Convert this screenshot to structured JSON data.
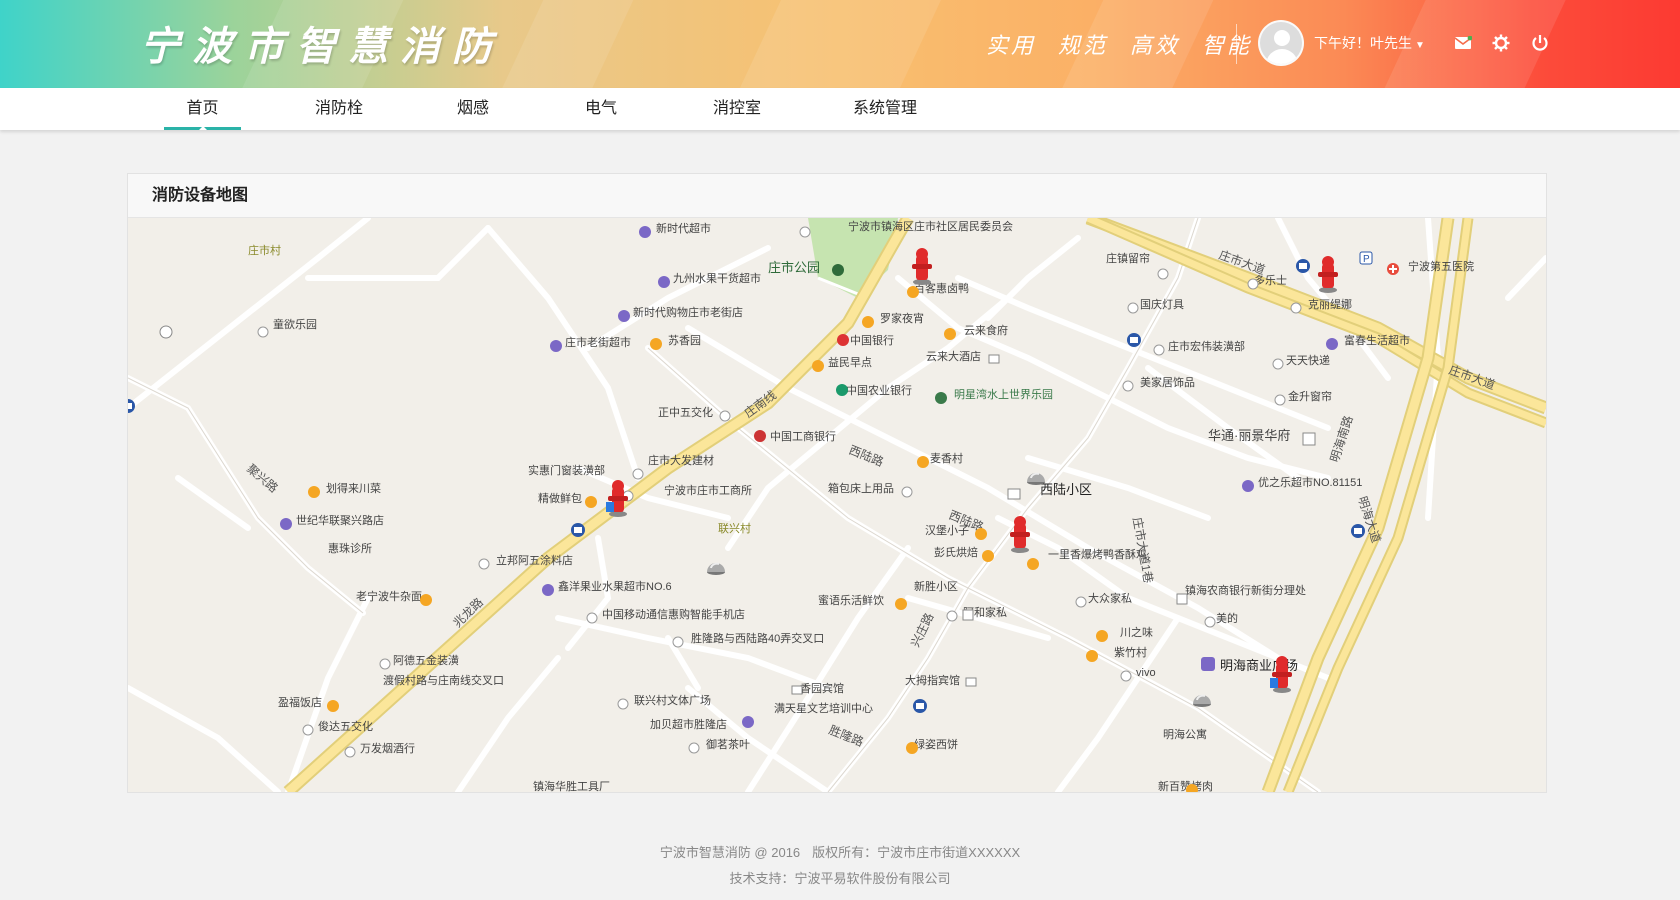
{
  "header": {
    "brand": "宁波市智慧消防",
    "slogan": [
      "实用",
      "规范",
      "高效",
      "智能"
    ],
    "greeting": "下午好！叶先生",
    "icons": [
      "mail-icon",
      "gear-icon",
      "power-icon"
    ]
  },
  "nav": {
    "items": [
      {
        "label": "首页",
        "active": true
      },
      {
        "label": "消防栓",
        "active": false
      },
      {
        "label": "烟感",
        "active": false
      },
      {
        "label": "电气",
        "active": false
      },
      {
        "label": "消控室",
        "active": false
      },
      {
        "label": "系统管理",
        "active": false
      }
    ]
  },
  "panel": {
    "title": "消防设备地图"
  },
  "map": {
    "roads": {
      "zhuangnan": "庄南线",
      "zhaolong": "兆龙路",
      "xilu": "西陆路",
      "xilu2": "西陆路",
      "zhuangshi_dadao": "庄市大道",
      "zhuangshi_dadao2": "庄市大道",
      "minghai": "明海南路",
      "minghai_dadao": "明海大道",
      "zhuangshi_dadao_yixiang": "庄市大道1巷",
      "xingzhuang": "兴庄路",
      "shenglong": "胜隆路",
      "juxing": "聚兴路"
    },
    "pois": [
      "新时代超市",
      "宁波市镇海区庄市社区居民委员会",
      "庄市村",
      "九州水果干货超市",
      "庄市公园",
      "百客惠卤鸭",
      "庄镇留帘",
      "多乐士",
      "宁波第五医院",
      "克丽缇娜",
      "童欲乐园",
      "新时代购物庄市老街店",
      "庄市老街超市",
      "苏香园",
      "罗家夜宵",
      "云来食府",
      "中国银行",
      "国庆灯具",
      "云来大酒店",
      "庄市宏伟装潢部",
      "富春生活超市",
      "益民早点",
      "天天快递",
      "中国农业银行",
      "明星湾水上世界乐园",
      "美家居饰品",
      "金升窗帘",
      "正中五交化",
      "华通·丽景华府",
      "中国工商银行",
      "庄市大发建材",
      "麦香村",
      "实惠门窗装潢部",
      "划得来川菜",
      "精做鲜包",
      "宁波市庄市工商所",
      "箱包床上用品",
      "西陆小区",
      "优之乐超市NO.81151",
      "世纪华联聚兴路店",
      "联兴村",
      "汉堡小子",
      "惠珠诊所",
      "彭氏烘焙",
      "一里香爆烤鸭香酥鸡",
      "立邦阿五涂料店",
      "鑫洋果业水果超市NO.6",
      "新胜小区",
      "大众家私",
      "镇海农商银行新街分理处",
      "老宁波牛杂面",
      "蜜语乐活鲜饮",
      "中国移动通信惠购智能手机店",
      "阿和家私",
      "美的",
      "川之味",
      "阿德五金装潢",
      "胜隆路与西陆路40弄交叉口",
      "紫竹村",
      "明海商业广场",
      "渡假村路与庄南线交叉口",
      "vivo",
      "盈福饭店",
      "香园宾馆",
      "大拇指宾馆",
      "联兴村文体广场",
      "俊达五交化",
      "满天星文艺培训中心",
      "加贝超市胜隆店",
      "明海公寓",
      "万发烟酒行",
      "御茗茶叶",
      "绿姿西饼",
      "新百赞烤肉",
      "镇海华胜工具厂"
    ],
    "hydrants": 5,
    "smoke_sensors": 3
  },
  "footer": {
    "line1_name": "宁波市智慧消防 @ 2016",
    "line1_copyright": "版权所有：宁波市庄市街道XXXXXX",
    "line2": "技术支持：宁波平易软件股份有限公司"
  }
}
